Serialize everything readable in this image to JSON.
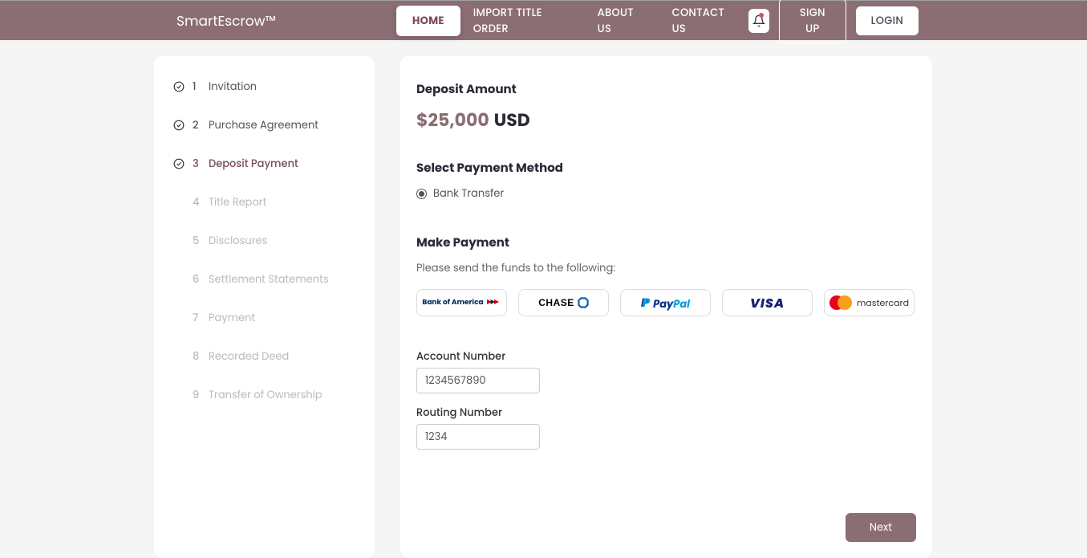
{
  "header": {
    "logo": "SmartEscrow™",
    "nav": {
      "home": "HOME",
      "import": "IMPORT TITLE ORDER",
      "about": "ABOUT US",
      "contact": "CONTACT US"
    },
    "signup": "SIGN UP",
    "login": "LOGIN"
  },
  "sidebar": {
    "steps": [
      {
        "num": "1",
        "label": "Invitation",
        "status": "done"
      },
      {
        "num": "2",
        "label": "Purchase Agreement",
        "status": "done"
      },
      {
        "num": "3",
        "label": "Deposit Payment",
        "status": "active"
      },
      {
        "num": "4",
        "label": "Title Report",
        "status": "pending"
      },
      {
        "num": "5",
        "label": "Disclosures",
        "status": "pending"
      },
      {
        "num": "6",
        "label": "Settlement Statements",
        "status": "pending"
      },
      {
        "num": "7",
        "label": "Payment",
        "status": "pending"
      },
      {
        "num": "8",
        "label": "Recorded Deed",
        "status": "pending"
      },
      {
        "num": "9",
        "label": "Transfer of Ownership",
        "status": "pending"
      }
    ]
  },
  "main": {
    "deposit_title": "Deposit Amount",
    "amount": "$25,000",
    "currency": "USD",
    "select_method_title": "Select Payment Method",
    "bank_transfer": "Bank Transfer",
    "make_payment_title": "Make Payment",
    "instructions": "Please send the funds to the following:",
    "paymethods": {
      "boa": "Bank of America",
      "chase": "CHASE",
      "paypal_pay": "Pay",
      "paypal_pal": "Pal",
      "visa": "VISA",
      "mastercard": "mastercard"
    },
    "account_label": "Account Number",
    "account_value": "1234567890",
    "routing_label": "Routing Number",
    "routing_value": "1234",
    "next": "Next"
  },
  "colors": {
    "brand": "#8b6e73",
    "accent": "#7a4c55"
  }
}
